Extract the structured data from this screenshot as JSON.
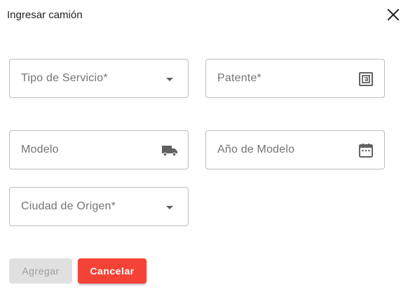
{
  "dialog": {
    "title": "Ingresar camión",
    "close_icon": "close-icon"
  },
  "fields": {
    "tipo_servicio": {
      "label": "Tipo de Servicio*",
      "value": "",
      "icon": "dropdown-arrow-icon"
    },
    "patente": {
      "label": "Patente*",
      "value": "",
      "icon": "license-plate-icon"
    },
    "modelo": {
      "label": "Modelo",
      "value": "",
      "icon": "truck-icon"
    },
    "anio_modelo": {
      "label": "Año de Modelo",
      "value": "",
      "icon": "calendar-icon"
    },
    "ciudad_origen": {
      "label": "Ciudad de Origen*",
      "value": "",
      "icon": "dropdown-arrow-icon"
    }
  },
  "actions": {
    "add_label": "Agregar",
    "add_disabled": true,
    "cancel_label": "Cancelar"
  },
  "colors": {
    "cancel": "#f44336",
    "disabled": "#e0e0e0",
    "border": "#bdbdbd",
    "label": "#757575"
  }
}
